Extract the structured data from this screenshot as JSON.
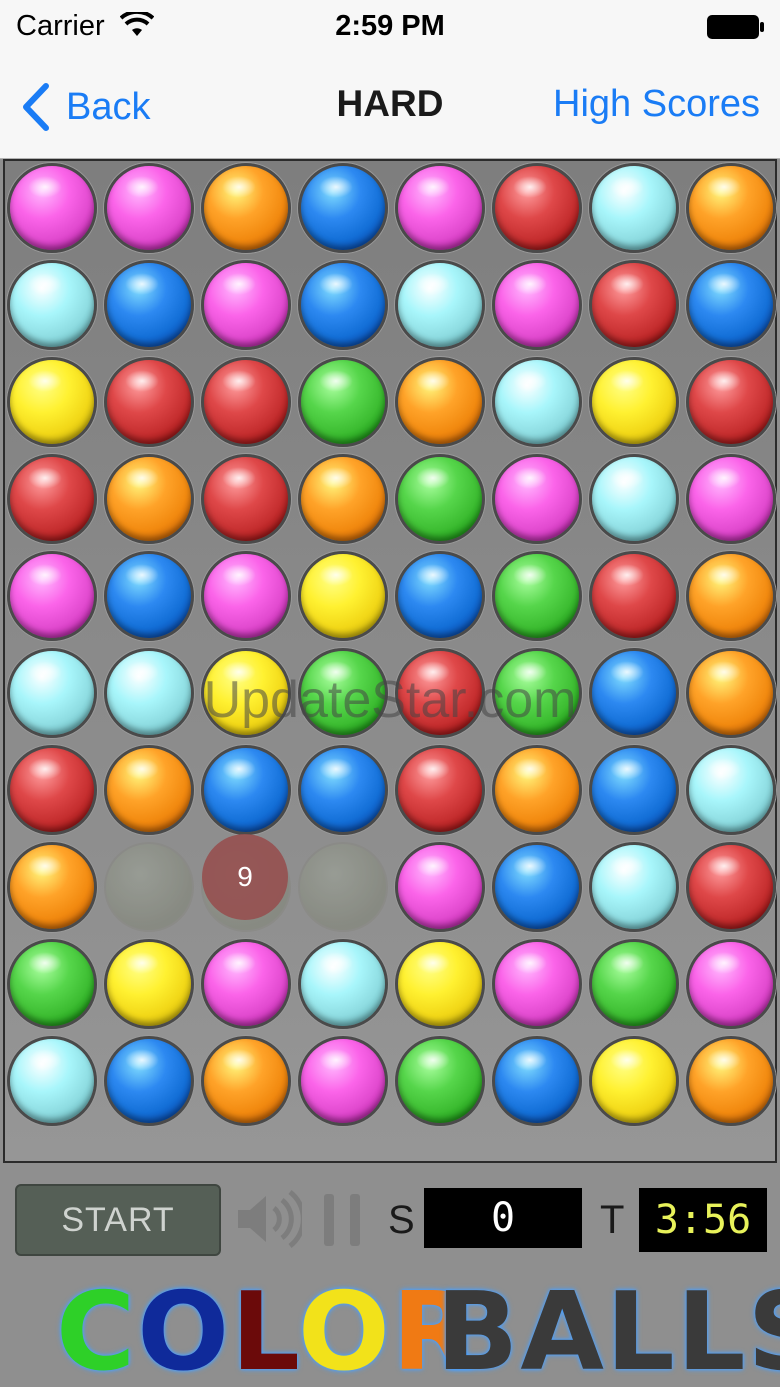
{
  "status_bar": {
    "carrier": "Carrier",
    "time": "2:59 PM"
  },
  "nav": {
    "back_label": "Back",
    "title": "HARD",
    "high_scores_label": "High Scores"
  },
  "palette": {
    "pink": "#e24bd0",
    "orange": "#f28a10",
    "blue": "#1470d8",
    "red": "#c62f30",
    "cyan": "#8fdde2",
    "yellow": "#f2d818",
    "green": "#3dbd32"
  },
  "board": [
    [
      "pink",
      "pink",
      "orange",
      "blue",
      "pink",
      "red",
      "cyan",
      "orange"
    ],
    [
      "cyan",
      "blue",
      "pink",
      "blue",
      "cyan",
      "pink",
      "red",
      "blue"
    ],
    [
      "yellow",
      "red",
      "red",
      "green",
      "orange",
      "cyan",
      "yellow",
      "red"
    ],
    [
      "red",
      "orange",
      "red",
      "orange",
      "green",
      "pink",
      "cyan",
      "pink"
    ],
    [
      "pink",
      "blue",
      "pink",
      "yellow",
      "blue",
      "green",
      "red",
      "orange"
    ],
    [
      "cyan",
      "cyan",
      "yellow",
      "green",
      "red",
      "green",
      "blue",
      "orange"
    ],
    [
      "red",
      "orange",
      "blue",
      "blue",
      "red",
      "orange",
      "blue",
      "cyan"
    ],
    [
      "orange",
      "empty",
      "empty",
      "empty",
      "pink",
      "blue",
      "cyan",
      "red"
    ],
    [
      "green",
      "yellow",
      "pink",
      "cyan",
      "yellow",
      "pink",
      "green",
      "pink"
    ],
    [
      "cyan",
      "blue",
      "orange",
      "pink",
      "green",
      "blue",
      "yellow",
      "orange"
    ]
  ],
  "popup": {
    "value": "9"
  },
  "watermark": "UpdateStar.com",
  "controls": {
    "start_label": "START",
    "score_label": "S",
    "score_value": "0",
    "time_label": "T",
    "time_value": "3:56"
  },
  "logo": {
    "color_word": [
      {
        "letter": "C",
        "color": "#2ed028"
      },
      {
        "letter": "O",
        "color": "#0f2a9a"
      },
      {
        "letter": "L",
        "color": "#6b0a0a"
      },
      {
        "letter": "O",
        "color": "#f2e21a"
      },
      {
        "letter": "R",
        "color": "#f07a14"
      }
    ],
    "balls_word": "BALLS"
  }
}
